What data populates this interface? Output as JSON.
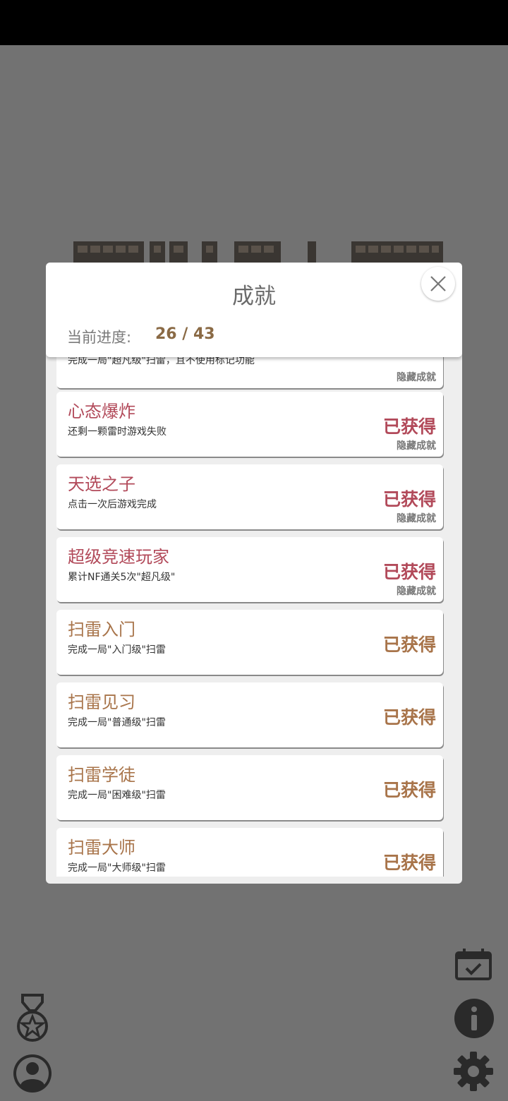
{
  "dialog": {
    "title": "成就",
    "progress_label": "当前进度:",
    "progress_value": "26 / 43"
  },
  "achievements": [
    {
      "name": "",
      "desc": "完成一局\"超凡级\"扫雷，且不使用标记功能",
      "status": "",
      "tag": "隐藏成就",
      "kind": "hidden"
    },
    {
      "name": "心态爆炸",
      "desc": "还剩一颗雷时游戏失败",
      "status": "已获得",
      "tag": "隐藏成就",
      "kind": "hidden"
    },
    {
      "name": "天选之子",
      "desc": "点击一次后游戏完成",
      "status": "已获得",
      "tag": "隐藏成就",
      "kind": "hidden"
    },
    {
      "name": "超级竞速玩家",
      "desc": "累计NF通关5次\"超凡级\"",
      "status": "已获得",
      "tag": "隐藏成就",
      "kind": "hidden"
    },
    {
      "name": "扫雷入门",
      "desc": "完成一局\"入门级\"扫雷",
      "status": "已获得",
      "tag": "",
      "kind": "normal"
    },
    {
      "name": "扫雷见习",
      "desc": "完成一局\"普通级\"扫雷",
      "status": "已获得",
      "tag": "",
      "kind": "normal"
    },
    {
      "name": "扫雷学徒",
      "desc": "完成一局\"困难级\"扫雷",
      "status": "已获得",
      "tag": "",
      "kind": "normal"
    },
    {
      "name": "扫雷大师",
      "desc": "完成一局\"大师级\"扫雷",
      "status": "已获得",
      "tag": "",
      "kind": "normal"
    }
  ],
  "icons": {
    "close": "close-icon",
    "achievements": "medal-star-icon",
    "profile": "user-avatar-icon",
    "daily": "calendar-check-icon",
    "info": "info-icon",
    "settings": "gear-icon"
  },
  "colors": {
    "hidden_accent": "#b24a5a",
    "normal_accent": "#a8744a",
    "background": "#727272"
  }
}
